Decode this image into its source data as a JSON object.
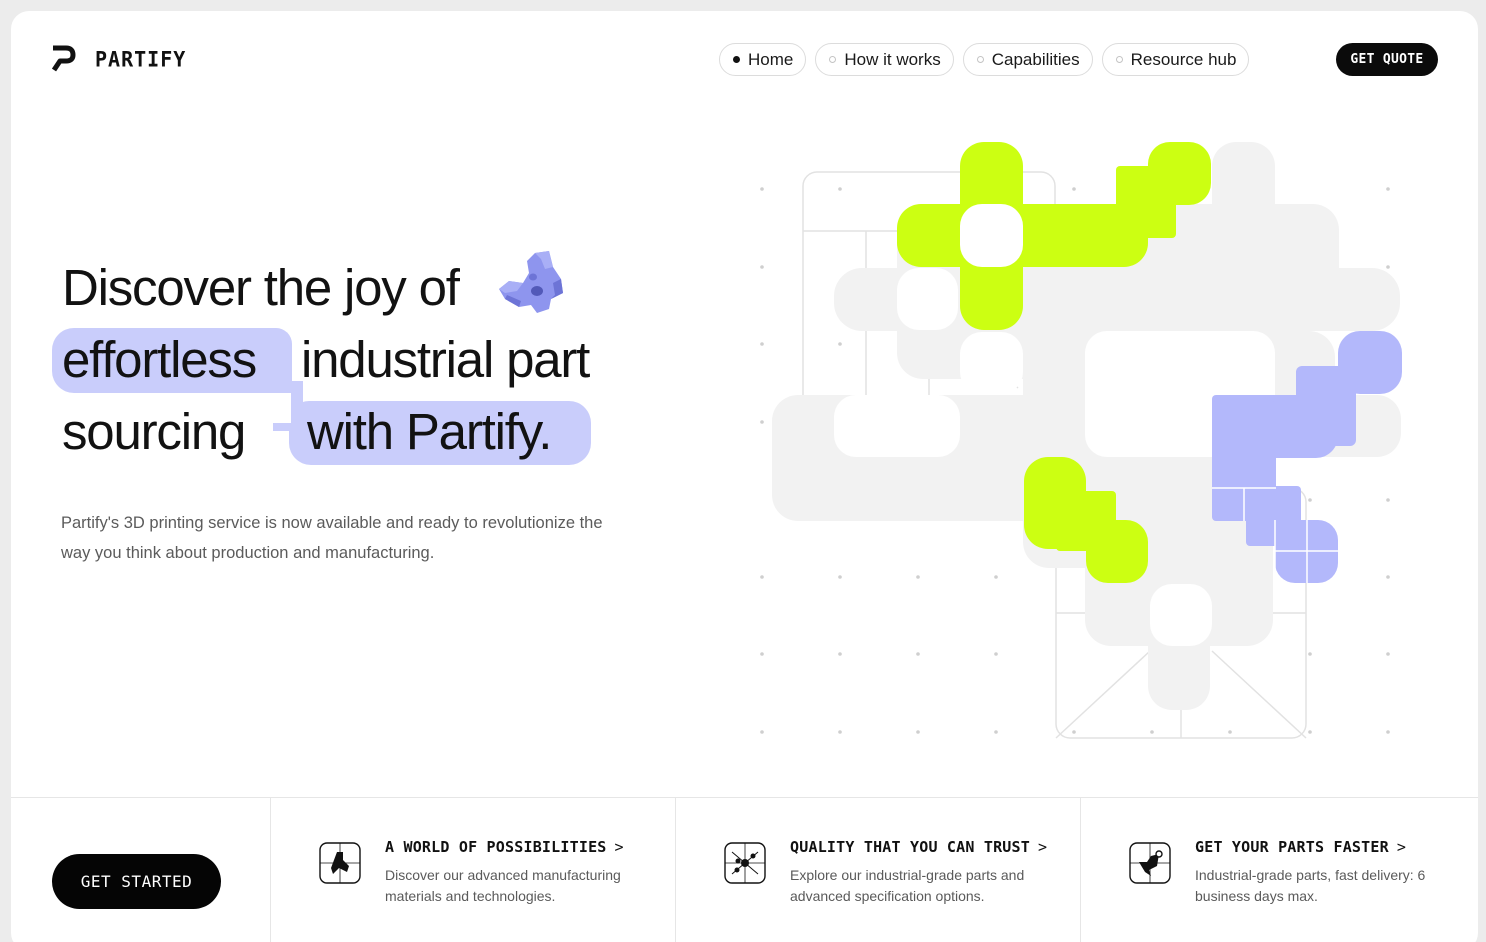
{
  "brand": {
    "name": "PARTIFY",
    "logo_icon": "partify-p-logo"
  },
  "nav": {
    "items": [
      {
        "label": "Home",
        "active": true
      },
      {
        "label": "How it works",
        "active": false
      },
      {
        "label": "Capabilities",
        "active": false
      },
      {
        "label": "Resource hub",
        "active": false
      }
    ],
    "quote_label": "GET QUOTE"
  },
  "hero": {
    "line1": "Discover the joy of",
    "line2_highlight": "effortless",
    "line2_rest": "industrial part",
    "line3_start": "sourcing",
    "line3_highlight": "with Partify.",
    "hero_icon": "3d-printed-part-icon",
    "subtitle": "Partify's 3D printing service is now available and ready to revolutionize the way you think about production and manufacturing."
  },
  "footer_strip": {
    "cta_label": "GET STARTED",
    "features": [
      {
        "title": "A WORLD OF POSSIBILITIES",
        "description": "Discover our advanced manufacturing materials and technologies.",
        "icon": "network-nodes-icon"
      },
      {
        "title": "QUALITY THAT YOU CAN TRUST",
        "description": "Explore our industrial-grade parts and advanced specification options.",
        "icon": "quality-nodes-icon"
      },
      {
        "title": "GET YOUR PARTS FASTER",
        "description": "Industrial-grade parts, fast delivery: 6 business days max.",
        "icon": "fast-delivery-nodes-icon"
      }
    ]
  },
  "colors": {
    "accent_lime": "#ccff12",
    "accent_lavender": "#b3b8fb",
    "highlight": "#c9cdfb",
    "dark": "#0b0b0b"
  }
}
